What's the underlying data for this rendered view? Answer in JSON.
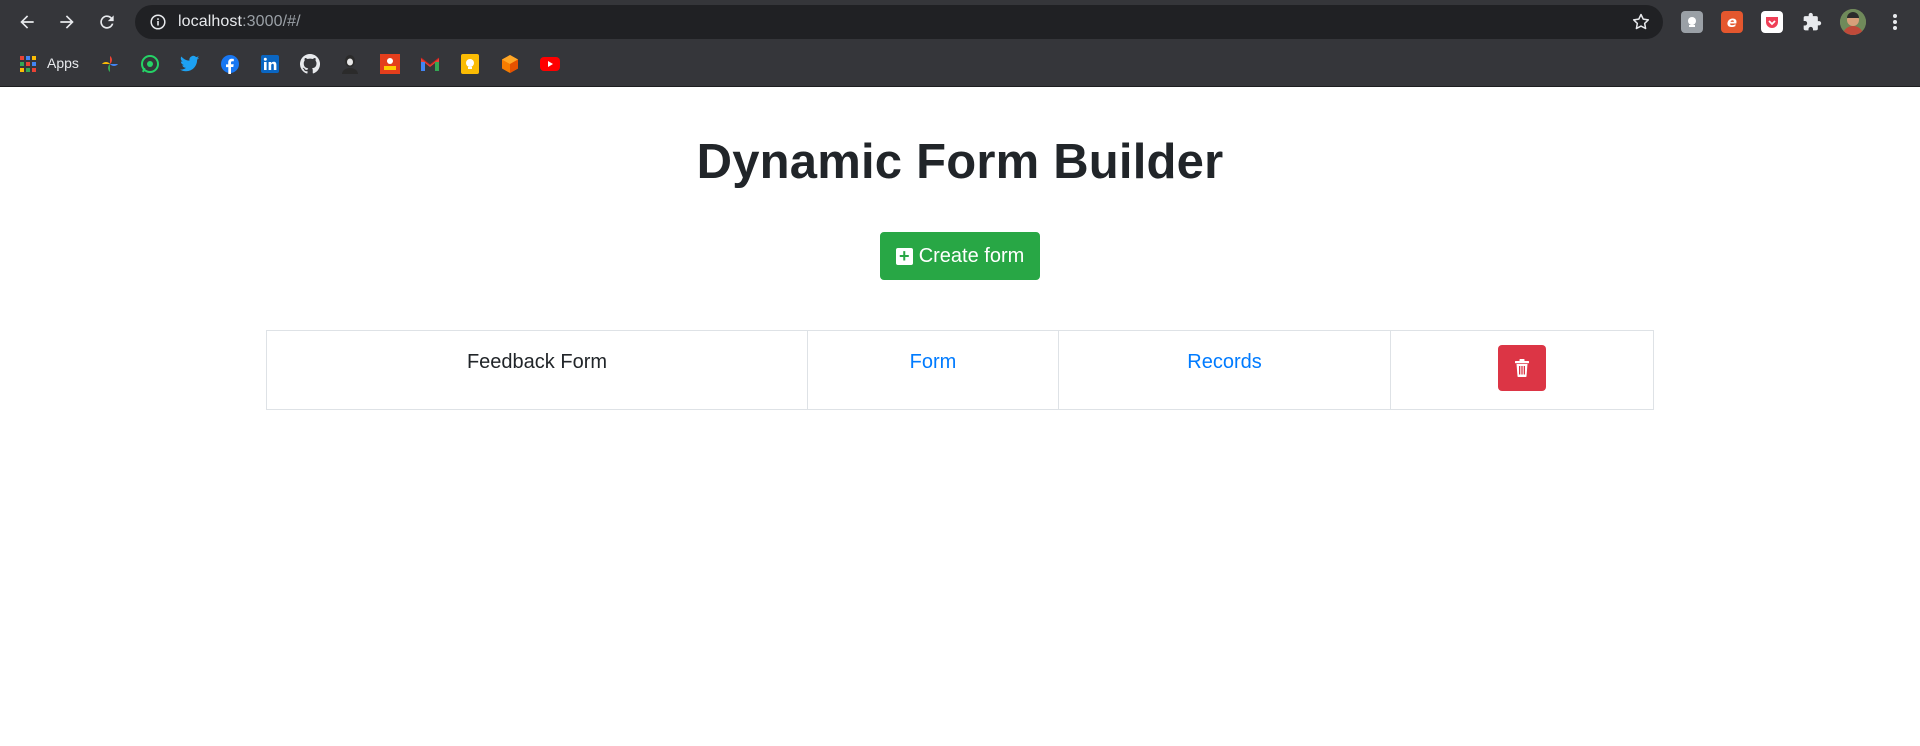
{
  "browser": {
    "url_host": "localhost",
    "url_path": ":3000/#/",
    "bookmarks": {
      "apps_label": "Apps",
      "items": [
        "pinwheel-icon",
        "whatsapp-icon",
        "twitter-icon",
        "facebook-icon",
        "linkedin-icon",
        "github-icon",
        "profile-icon",
        "bookmark-red-icon",
        "gmail-icon",
        "keep-icon",
        "cube-icon",
        "youtube-icon"
      ]
    },
    "extensions": [
      "screenshot-extension-icon",
      "edge-e-extension-icon",
      "pocket-icon",
      "puzzle-extensions-icon",
      "profile-avatar",
      "kebab-menu-icon"
    ]
  },
  "page": {
    "title": "Dynamic Form Builder",
    "create_button_label": "Create form",
    "forms": [
      {
        "name": "Feedback Form",
        "form_link": "Form",
        "records_link": "Records"
      }
    ]
  },
  "colors": {
    "success": "#28a745",
    "danger": "#dc3545",
    "link": "#007bff",
    "text": "#212529"
  }
}
